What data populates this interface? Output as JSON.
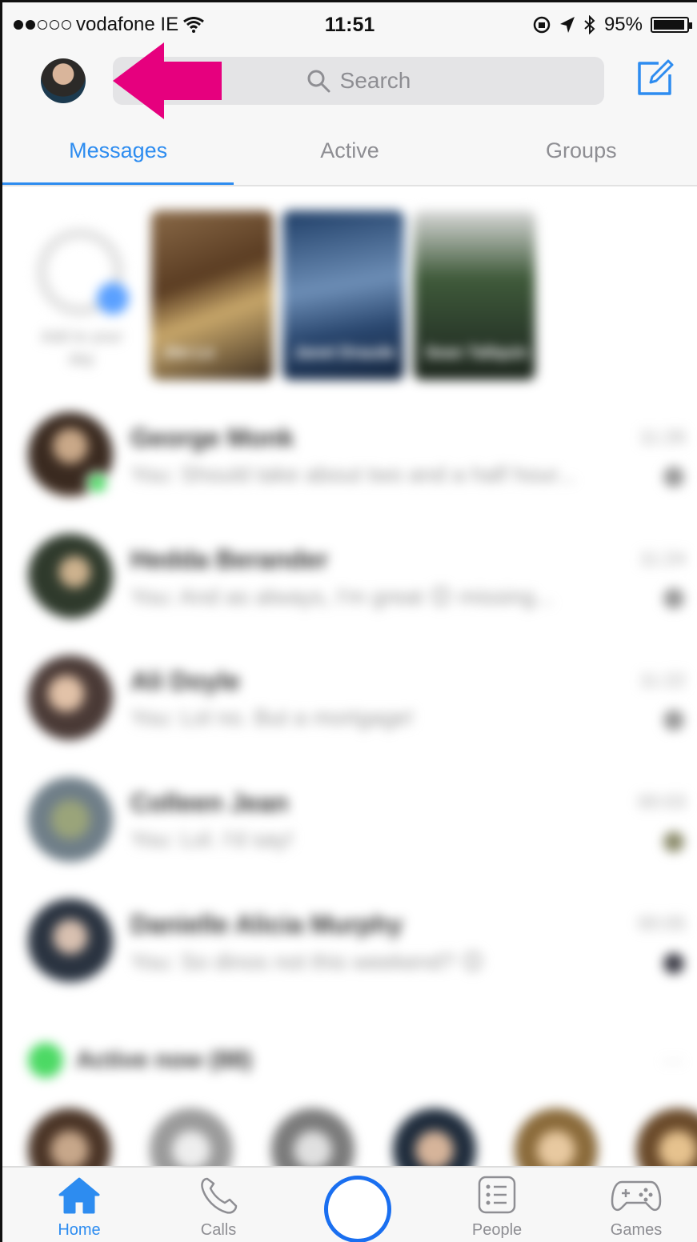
{
  "status_bar": {
    "carrier": "vodafone IE",
    "time": "11:51",
    "battery": "95%",
    "battery_level": 0.95
  },
  "header": {
    "search_placeholder": "Search",
    "tabs": [
      {
        "label": "Messages",
        "active": true
      },
      {
        "label": "Active",
        "active": false
      },
      {
        "label": "Groups",
        "active": false
      }
    ]
  },
  "stories": {
    "add_caption": "Add to your day",
    "items": [
      {
        "caption": "Jim Lo"
      },
      {
        "caption": "Janet Draude"
      },
      {
        "caption": "Sean Tallquin"
      }
    ]
  },
  "conversations": [
    {
      "name": "George Monk",
      "preview": "You: Should take about two and a half hour...",
      "time": "11:26",
      "online": true
    },
    {
      "name": "Hedda Berander",
      "preview": "You: And as always, I'm great 😊 missing...",
      "time": "11:24",
      "online": false
    },
    {
      "name": "Ali Doyle",
      "preview": "You: Lol no. But a mortgage!",
      "time": "11:22",
      "online": false
    },
    {
      "name": "Colleen Jean",
      "preview": "You: Lol. I'd say!",
      "time": "00:03",
      "online": false
    },
    {
      "name": "Danielle Alicia Murphy",
      "preview": "You: So dinos not this weekend? 😊",
      "time": "00:05",
      "online": false
    }
  ],
  "active_now": {
    "label": "Active now (88)",
    "more": "···"
  },
  "tab_bar": {
    "items": [
      {
        "label": "Home",
        "icon": "home-icon",
        "active": true
      },
      {
        "label": "Calls",
        "icon": "phone-icon",
        "active": false
      },
      {
        "label": "People",
        "icon": "people-list-icon",
        "active": false
      },
      {
        "label": "Games",
        "icon": "gamepad-icon",
        "active": false
      }
    ]
  },
  "colors": {
    "accent": "#2d8cf0",
    "arrow": "#e6007e",
    "online": "#4cd964"
  }
}
